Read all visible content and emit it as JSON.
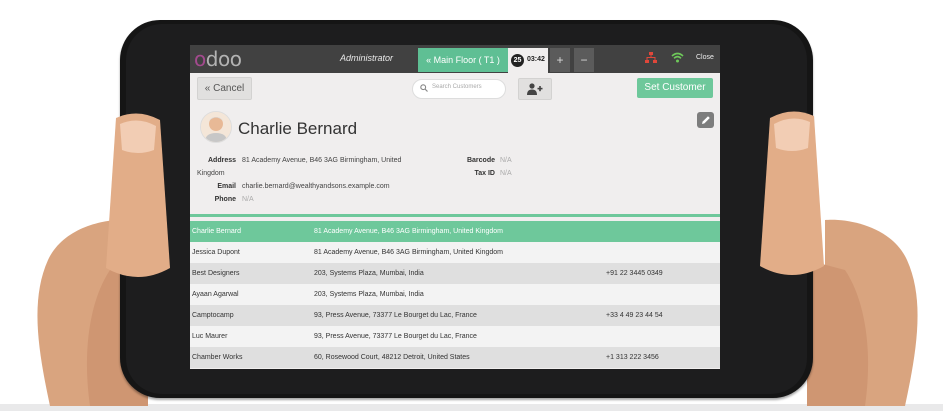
{
  "topbar": {
    "logo": [
      "o",
      "d",
      "o",
      "o"
    ],
    "user": "Administrator",
    "floor_button": "« Main Floor ( T1 )",
    "order_number": "25",
    "order_time": "03:42",
    "add_order": "+",
    "remove_order": "−",
    "close": "Close"
  },
  "controls": {
    "cancel": "« Cancel",
    "search_placeholder": "Search Customers",
    "set_customer": "Set Customer"
  },
  "customer": {
    "name": "Charlie Bernard",
    "address_label": "Address",
    "address_line1": "81 Academy Avenue, B46 3AG Birmingham, United",
    "address_line2": "Kingdom",
    "email_label": "Email",
    "email": "charlie.bernard@wealthyandsons.example.com",
    "phone_label": "Phone",
    "phone": "N/A",
    "barcode_label": "Barcode",
    "barcode": "N/A",
    "taxid_label": "Tax ID",
    "taxid": "N/A"
  },
  "customers": [
    {
      "name": "Charlie Bernard",
      "address": "81 Academy Avenue, B46 3AG Birmingham, United Kingdom",
      "phone": ""
    },
    {
      "name": "Jessica Dupont",
      "address": "81 Academy Avenue, B46 3AG Birmingham, United Kingdom",
      "phone": ""
    },
    {
      "name": "Best Designers",
      "address": "203, Systems Plaza, Mumbai, India",
      "phone": "+91 22 3445 0349"
    },
    {
      "name": "Ayaan Agarwal",
      "address": "203, Systems Plaza, Mumbai, India",
      "phone": ""
    },
    {
      "name": "Camptocamp",
      "address": "93, Press Avenue, 73377 Le Bourget du Lac, France",
      "phone": "+33 4 49 23 44 54"
    },
    {
      "name": "Luc Maurer",
      "address": "93, Press Avenue, 73377 Le Bourget du Lac, France",
      "phone": ""
    },
    {
      "name": "Chamber Works",
      "address": "60, Rosewood Court, 48212 Detroit, United States",
      "phone": "+1 313 222 3456"
    }
  ],
  "colors": {
    "accent": "#6ec89b",
    "topbar": "#414141",
    "brand": "#a34a8e"
  }
}
